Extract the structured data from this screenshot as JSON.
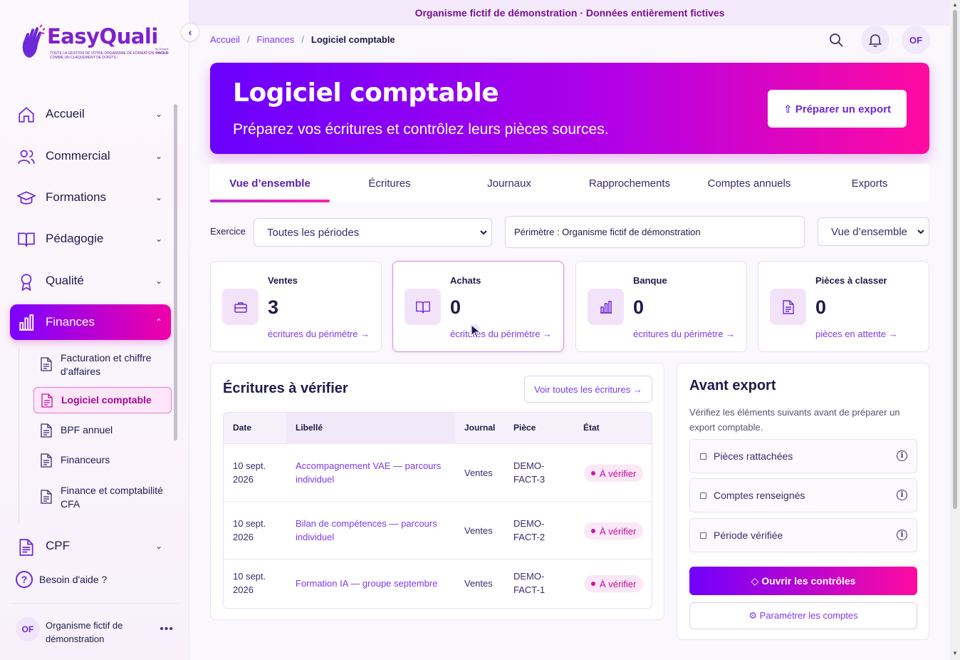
{
  "sidebar": {
    "logo": {
      "title": "EasyQuali",
      "by": "by Groupe EasyQUAL",
      "tagline": "Toute la gestion de votre organisme de formation, facile comme un claquement de doigts !"
    },
    "collapse_icon": "chevron-left-icon",
    "items": [
      {
        "label": "Accueil",
        "icon": "home-icon"
      },
      {
        "label": "Commercial",
        "icon": "users-icon"
      },
      {
        "label": "Formations",
        "icon": "graduation-cap-icon"
      },
      {
        "label": "Pédagogie",
        "icon": "book-open-icon"
      },
      {
        "label": "Qualité",
        "icon": "award-icon"
      },
      {
        "label": "Finances",
        "icon": "bar-chart-icon",
        "active": true
      },
      {
        "label": "CPF",
        "icon": "document-icon"
      }
    ],
    "subitems": [
      {
        "label": "Facturation et chiffre d'affaires"
      },
      {
        "label": "Logiciel comptable",
        "active": true
      },
      {
        "label": "BPF annuel"
      },
      {
        "label": "Financeurs"
      },
      {
        "label": "Finance et comptabilité CFA"
      }
    ],
    "help": "Besoin d'aide ?",
    "org": {
      "initials": "OF",
      "name": "Organisme fictif de démonstration",
      "more": "•••"
    }
  },
  "banner": "Organisme fictif de démonstration · Données entièrement fictives",
  "breadcrumb": {
    "items": [
      "Accueil",
      "Finances"
    ],
    "current": "Logiciel comptable",
    "sep": "/"
  },
  "topbar": {
    "search_icon": "search-icon",
    "bell_icon": "bell-icon",
    "avatar": "OF"
  },
  "hero": {
    "title": "Logiciel comptable",
    "subtitle": "Préparez vos écritures et contrôlez leurs pièces sources.",
    "button": "⇧ Préparer un export"
  },
  "tabs": [
    "Vue d’ensemble",
    "Écritures",
    "Journaux",
    "Rapprochements",
    "Comptes annuels",
    "Exports"
  ],
  "active_tab": "Vue d’ensemble",
  "filters": {
    "label": "Exercice",
    "period": "Toutes les périodes",
    "scope": "Périmètre : Organisme fictif de démonstration",
    "view": "Vue d’ensemble"
  },
  "cards": [
    {
      "title": "Ventes",
      "value": "3",
      "link": "écritures du périmètre →",
      "icon": "briefcase-icon"
    },
    {
      "title": "Achats",
      "value": "0",
      "link": "écritures du périmètre →",
      "icon": "book-open-icon"
    },
    {
      "title": "Banque",
      "value": "0",
      "link": "écritures du périmètre →",
      "icon": "bar-chart-icon"
    },
    {
      "title": "Pièces à classer",
      "value": "0",
      "link": "pièces en attente →",
      "icon": "document-icon"
    }
  ],
  "entries": {
    "title": "Écritures à vérifier",
    "view_all": "Voir toutes les écritures →",
    "columns": [
      "Date",
      "Libellé",
      "Journal",
      "Pièce",
      "État"
    ],
    "rows": [
      {
        "date": "10 sept. 2026",
        "label": "Accompagnement VAE — parcours individuel",
        "journal": "Ventes",
        "piece": "DEMO-FACT-3",
        "status": "À vérifier"
      },
      {
        "date": "10 sept. 2026",
        "label": "Bilan de compétences — parcours individuel",
        "journal": "Ventes",
        "piece": "DEMO-FACT-2",
        "status": "À vérifier"
      },
      {
        "date": "10 sept. 2026",
        "label": "Formation IA — groupe septembre",
        "journal": "Ventes",
        "piece": "DEMO-FACT-1",
        "status": "À vérifier"
      }
    ]
  },
  "export_panel": {
    "title": "Avant export",
    "description": "Vérifiez les éléments suivants avant de préparer un export comptable.",
    "checks": [
      "Pièces rattachées",
      "Comptes renseignés",
      "Période vérifiée"
    ],
    "info_glyph": "i",
    "primary": "◇ Ouvrir les contrôles",
    "secondary": "⚙ Paramétrer les comptes"
  },
  "colors": {
    "accent": "#7c3aed",
    "gradient_start": "#6a00ff",
    "gradient_end": "#ff0aa0",
    "badge": "#be0d9b"
  }
}
